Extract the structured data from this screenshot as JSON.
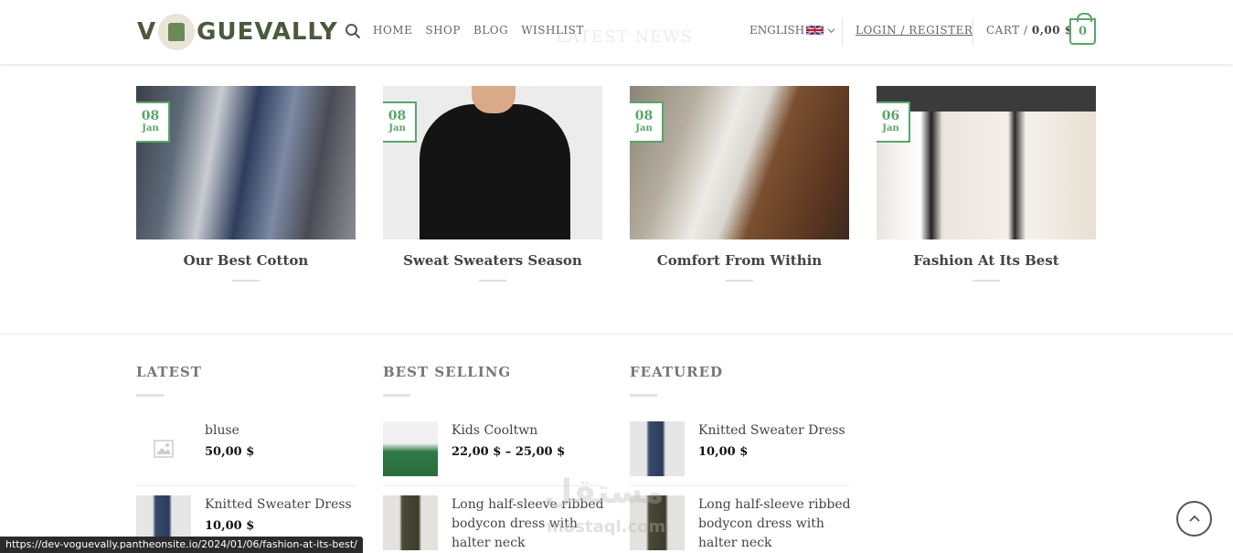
{
  "header": {
    "logo_left": "V",
    "logo_right": "GUEVALLY",
    "nav": [
      "HOME",
      "SHOP",
      "BLOG",
      "WISHLIST"
    ],
    "ghost_title": "LATEST NEWS",
    "language": "ENGLISH",
    "login": "LOGIN / REGISTER",
    "cart_label": "CART /",
    "cart_total": "0,00 $",
    "cart_count": "0"
  },
  "posts": [
    {
      "day": "08",
      "month": "Jan",
      "title": "Our Best Cotton"
    },
    {
      "day": "08",
      "month": "Jan",
      "title": "Sweat Sweaters Season"
    },
    {
      "day": "08",
      "month": "Jan",
      "title": "Comfort From Within"
    },
    {
      "day": "06",
      "month": "Jan",
      "title": "Fashion At Its Best"
    }
  ],
  "columns": [
    {
      "title": "LATEST",
      "items": [
        {
          "name": "bluse",
          "price": "50,00 $"
        },
        {
          "name": "Knitted Sweater Dress",
          "price": "10,00 $"
        }
      ]
    },
    {
      "title": "BEST SELLING",
      "items": [
        {
          "name": "Kids Cooltwn",
          "price": "22,00 $ – 25,00 $"
        },
        {
          "name": "Long half-sleeve ribbed bodycon dress with halter neck",
          "price": ""
        }
      ]
    },
    {
      "title": "FEATURED",
      "items": [
        {
          "name": "Knitted Sweater Dress",
          "price": "10,00 $"
        },
        {
          "name": "Long half-sleeve ribbed bodycon dress with halter neck",
          "price": ""
        }
      ]
    }
  ],
  "status_url": "https://dev-voguevally.pantheonsite.io/2024/01/06/fashion-at-its-best/",
  "watermark": "مستقل",
  "watermark_sub": "mostaql.com",
  "colors": {
    "accent": "#5aa56a",
    "logo": "#4a5a3c"
  }
}
